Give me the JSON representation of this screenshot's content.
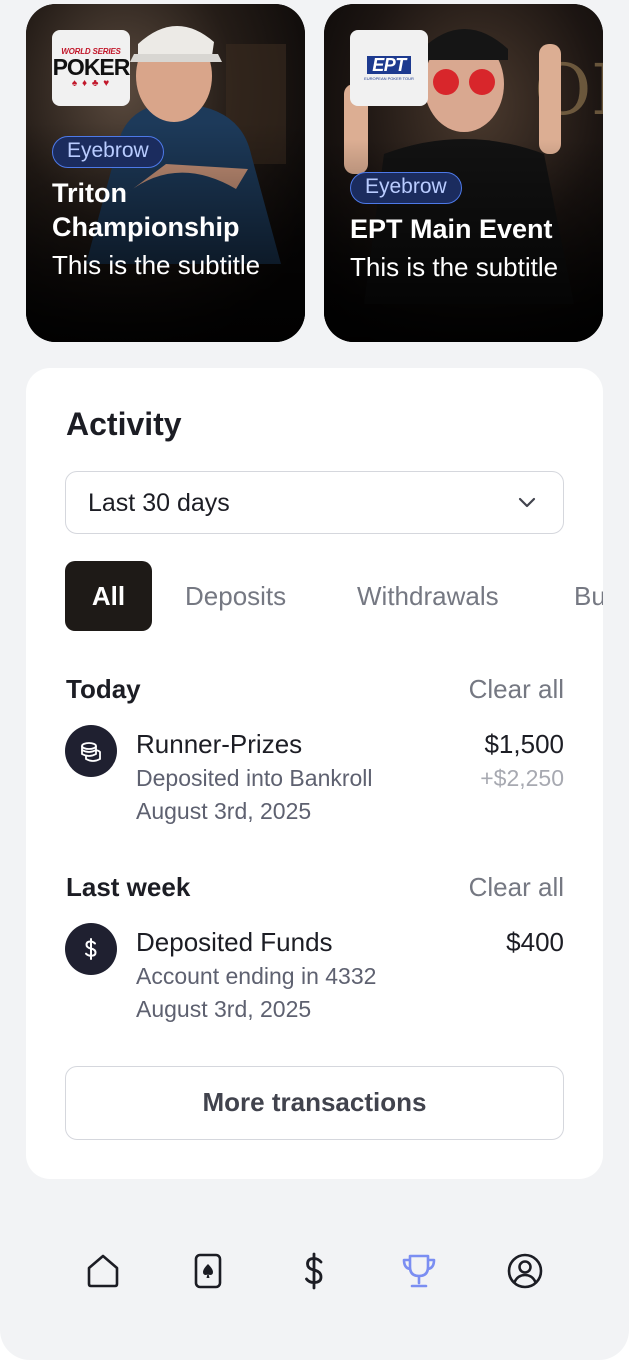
{
  "cards": [
    {
      "logo_top": "WORLD SERIES",
      "logo_main": "POKER",
      "logo_suits": "♠ ♦ ♣ ♥",
      "eyebrow": "Eyebrow",
      "title": "Triton Championship",
      "subtitle": "This is the subtitle"
    },
    {
      "logo_main": "EPT",
      "logo_sub": "EUROPEAN POKER TOUR",
      "eyebrow": "Eyebrow",
      "title": "EPT Main Event",
      "subtitle": "This is the subtitle"
    }
  ],
  "activity": {
    "title": "Activity",
    "range": {
      "value": "Last 30 days",
      "icon": "chevron-down-icon"
    },
    "tabs": [
      "All",
      "Deposits",
      "Withdrawals",
      "Bu"
    ],
    "active_tab": "All",
    "sections": [
      {
        "title": "Today",
        "clear_label": "Clear all",
        "items": [
          {
            "icon": "coins-icon",
            "title": "Runner-Prizes",
            "line2": "Deposited into Bankroll",
            "date": "August 3rd, 2025",
            "amount": "$1,500",
            "sub_amount": "+$2,250"
          }
        ]
      },
      {
        "title": "Last week",
        "clear_label": "Clear all",
        "items": [
          {
            "icon": "dollar-icon",
            "title": "Deposited Funds",
            "line2": "Account ending in 4332",
            "date": "August 3rd, 2025",
            "amount": "$400"
          }
        ]
      }
    ],
    "more_label": "More transactions"
  },
  "nav": {
    "items": [
      "home-icon",
      "card-icon",
      "dollar-icon",
      "trophy-icon",
      "profile-icon"
    ],
    "active": "trophy-icon"
  },
  "colors": {
    "eyebrow_bg": "#1b2c5e",
    "eyebrow_border": "#4d79e8",
    "nav_active": "#7b8ef2",
    "nav_inactive": "#1c1d24",
    "tab_active_bg": "#1e1a17"
  }
}
